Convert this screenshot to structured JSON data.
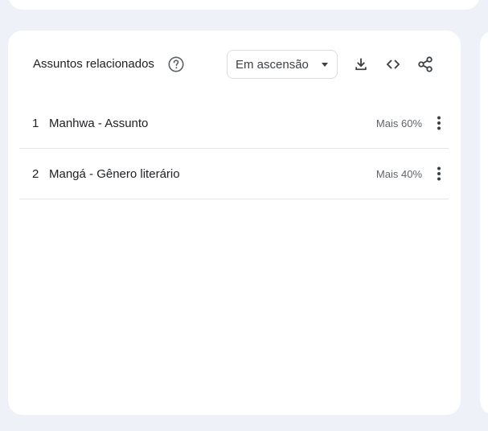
{
  "panel": {
    "title": "Assuntos relacionados",
    "help_icon": "help-circle-icon",
    "filter_select": {
      "selected": "Em ascensão"
    },
    "toolbar_icons": [
      "download-icon",
      "embed-code-icon",
      "share-icon"
    ],
    "items": [
      {
        "rank": "1",
        "label": "Manhwa - Assunto",
        "value": "Mais 60%",
        "menu_icon": "more-vert-icon"
      },
      {
        "rank": "2",
        "label": "Mangá - Gênero literário",
        "value": "Mais 40%",
        "menu_icon": "more-vert-icon"
      }
    ]
  },
  "colors": {
    "page_background": "#eef2f8",
    "card_background": "#ffffff",
    "divider": "#e6e6e6",
    "icon": "#3c4043",
    "secondary_text": "#5f6368"
  }
}
